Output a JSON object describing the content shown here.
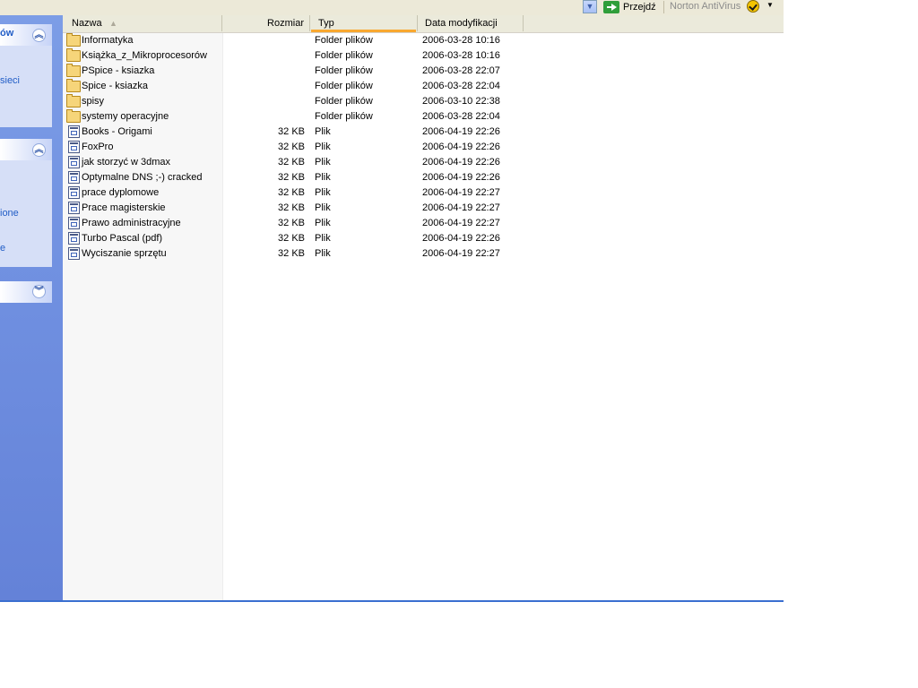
{
  "toolbar": {
    "go_label": "Przejdź",
    "norton_label": "Norton AntiVirus"
  },
  "taskpane": {
    "panel1_title": "ów",
    "panel1_link": "sieci",
    "panel2_link1": "ione",
    "panel2_link2": "e"
  },
  "columns": {
    "name": "Nazwa",
    "size": "Rozmiar",
    "type": "Typ",
    "date": "Data modyfikacji"
  },
  "files": [
    {
      "name": "Informatyka",
      "size": "",
      "type": "Folder plików",
      "date": "2006-03-28 10:16",
      "kind": "folder"
    },
    {
      "name": "Książka_z_Mikroprocesorów",
      "size": "",
      "type": "Folder plików",
      "date": "2006-03-28 10:16",
      "kind": "folder"
    },
    {
      "name": "PSpice - ksiazka",
      "size": "",
      "type": "Folder plików",
      "date": "2006-03-28 22:07",
      "kind": "folder"
    },
    {
      "name": "Spice - ksiazka",
      "size": "",
      "type": "Folder plików",
      "date": "2006-03-28 22:04",
      "kind": "folder"
    },
    {
      "name": "spisy",
      "size": "",
      "type": "Folder plików",
      "date": "2006-03-10 22:38",
      "kind": "folder"
    },
    {
      "name": "systemy operacyjne",
      "size": "",
      "type": "Folder plików",
      "date": "2006-03-28 22:04",
      "kind": "folder"
    },
    {
      "name": "Books - Origami",
      "size": "32 KB",
      "type": "Plik",
      "date": "2006-04-19 22:26",
      "kind": "file"
    },
    {
      "name": "FoxPro",
      "size": "32 KB",
      "type": "Plik",
      "date": "2006-04-19 22:26",
      "kind": "file"
    },
    {
      "name": "jak storzyć w 3dmax",
      "size": "32 KB",
      "type": "Plik",
      "date": "2006-04-19 22:26",
      "kind": "file"
    },
    {
      "name": "Optymalne DNS ;-) cracked",
      "size": "32 KB",
      "type": "Plik",
      "date": "2006-04-19 22:26",
      "kind": "file"
    },
    {
      "name": "prace dyplomowe",
      "size": "32 KB",
      "type": "Plik",
      "date": "2006-04-19 22:27",
      "kind": "file"
    },
    {
      "name": "Prace magisterskie",
      "size": "32 KB",
      "type": "Plik",
      "date": "2006-04-19 22:27",
      "kind": "file"
    },
    {
      "name": "Prawo administracyjne",
      "size": "32 KB",
      "type": "Plik",
      "date": "2006-04-19 22:27",
      "kind": "file"
    },
    {
      "name": "Turbo Pascal (pdf)",
      "size": "32 KB",
      "type": "Plik",
      "date": "2006-04-19 22:26",
      "kind": "file"
    },
    {
      "name": "Wyciszanie sprzętu",
      "size": "32 KB",
      "type": "Plik",
      "date": "2006-04-19 22:27",
      "kind": "file"
    }
  ]
}
